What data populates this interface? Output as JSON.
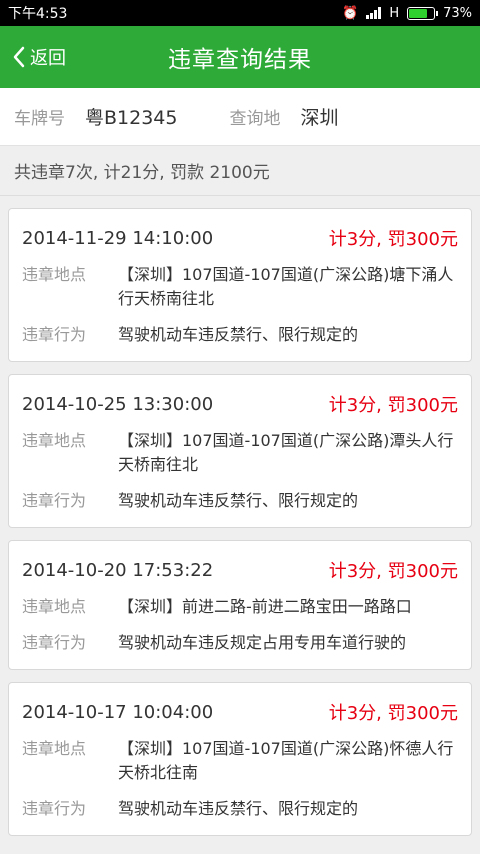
{
  "status_bar": {
    "time": "下午4:53",
    "network": "H",
    "battery": "73%",
    "battery_level": 0.73
  },
  "nav": {
    "back_label": "返回",
    "title": "违章查询结果"
  },
  "query": {
    "plate_label": "车牌号",
    "plate_value": "粤B12345",
    "city_label": "查询地",
    "city_value": "深圳"
  },
  "summary": "共违章7次, 计21分, 罚款 2100元",
  "labels": {
    "location": "违章地点",
    "behavior": "违章行为"
  },
  "violations": [
    {
      "time": "2014-11-29 14:10:00",
      "penalty": "计3分, 罚300元",
      "location": "【深圳】107国道-107国道(广深公路)塘下涌人行天桥南往北",
      "behavior": "驾驶机动车违反禁行、限行规定的"
    },
    {
      "time": "2014-10-25 13:30:00",
      "penalty": "计3分, 罚300元",
      "location": "【深圳】107国道-107国道(广深公路)潭头人行天桥南往北",
      "behavior": "驾驶机动车违反禁行、限行规定的"
    },
    {
      "time": "2014-10-20 17:53:22",
      "penalty": "计3分, 罚300元",
      "location": "【深圳】前进二路-前进二路宝田一路路口",
      "behavior": "驾驶机动车违反规定占用专用车道行驶的"
    },
    {
      "time": "2014-10-17 10:04:00",
      "penalty": "计3分, 罚300元",
      "location": "【深圳】107国道-107国道(广深公路)怀德人行天桥北往南",
      "behavior": "驾驶机动车违反禁行、限行规定的"
    }
  ],
  "colors": {
    "primary": "#2daa38",
    "penalty": "#e60012"
  }
}
